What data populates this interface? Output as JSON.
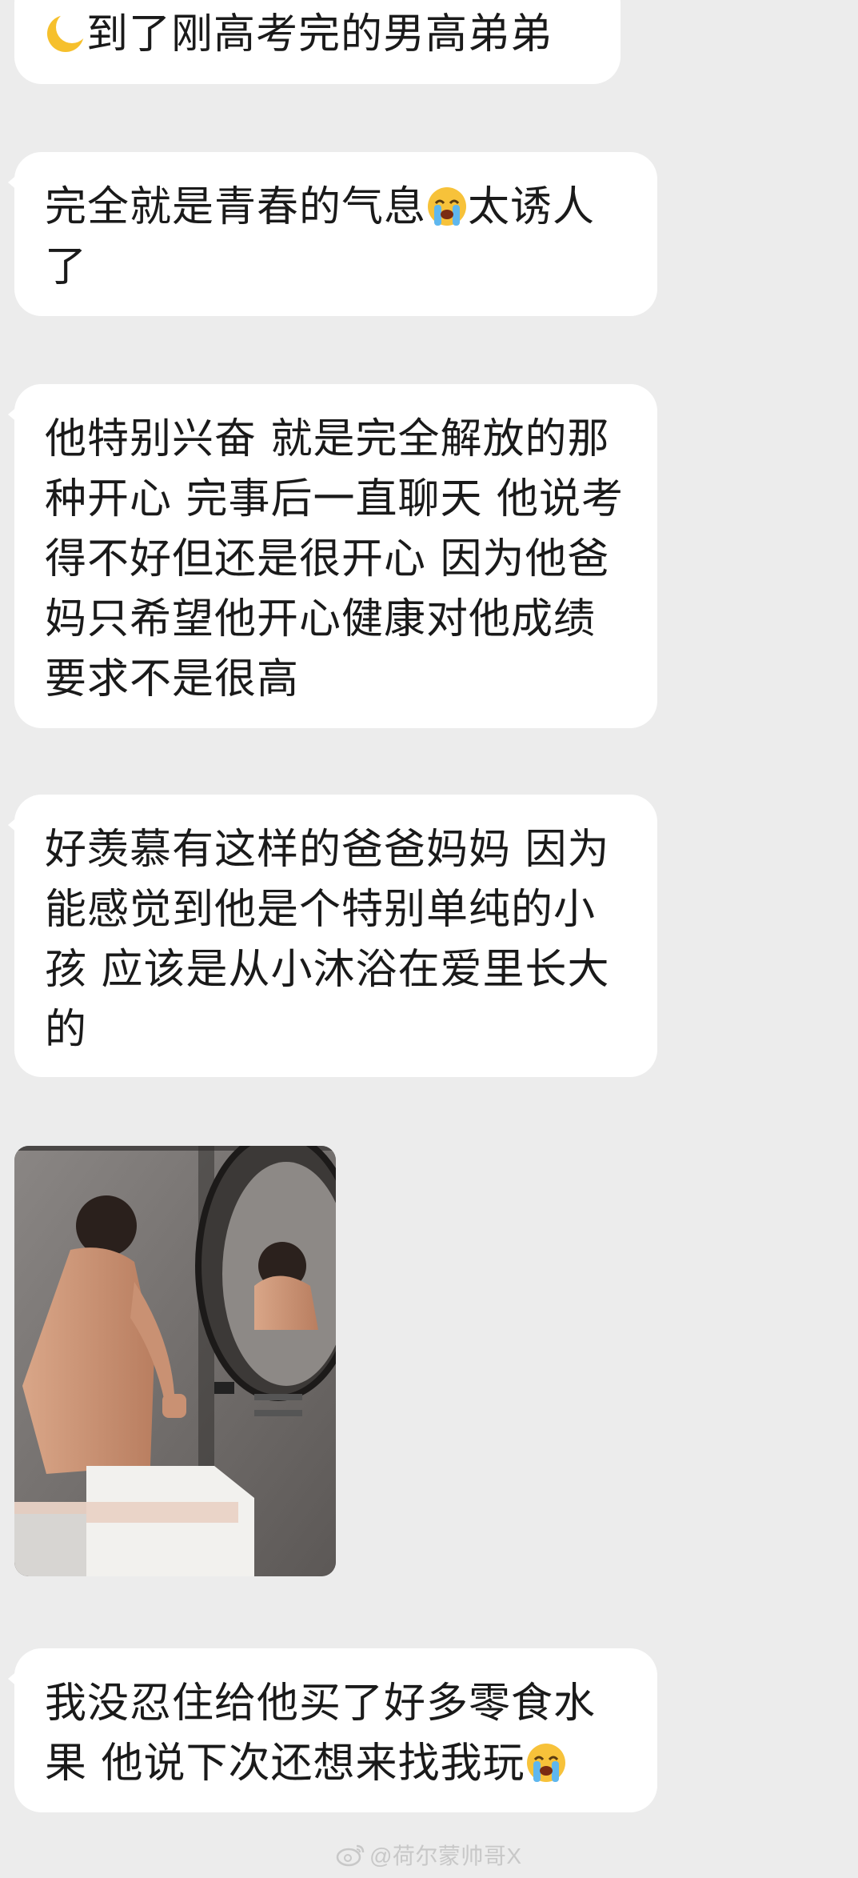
{
  "messages": [
    {
      "pre_icon": "crescent-moon",
      "text": "到了刚高考完的男高弟弟"
    },
    {
      "text_before": "完全就是青春的气息",
      "icon": "loudly-crying-face",
      "text_after": "太诱人了"
    },
    {
      "text": "他特别兴奋 就是完全解放的那种开心 完事后一直聊天 他说考得不好但还是很开心 因为他爸妈只希望他开心健康对他成绩要求不是很高"
    },
    {
      "text": "好羡慕有这样的爸爸妈妈 因为能感觉到他是个特别单纯的小孩 应该是从小沐浴在爱里长大的"
    },
    {
      "text_before": "我没忍住给他买了好多零食水果 他说下次还想来找我玩",
      "icon": "loudly-crying-face"
    }
  ],
  "photo": {
    "subject": "bathroom-mirror-photo"
  },
  "watermark": {
    "text": "@荷尔蒙帅哥X",
    "icon": "weibo-logo"
  },
  "colors": {
    "background": "#ececec",
    "bubble": "#ffffff",
    "text": "#1a1a1a"
  }
}
